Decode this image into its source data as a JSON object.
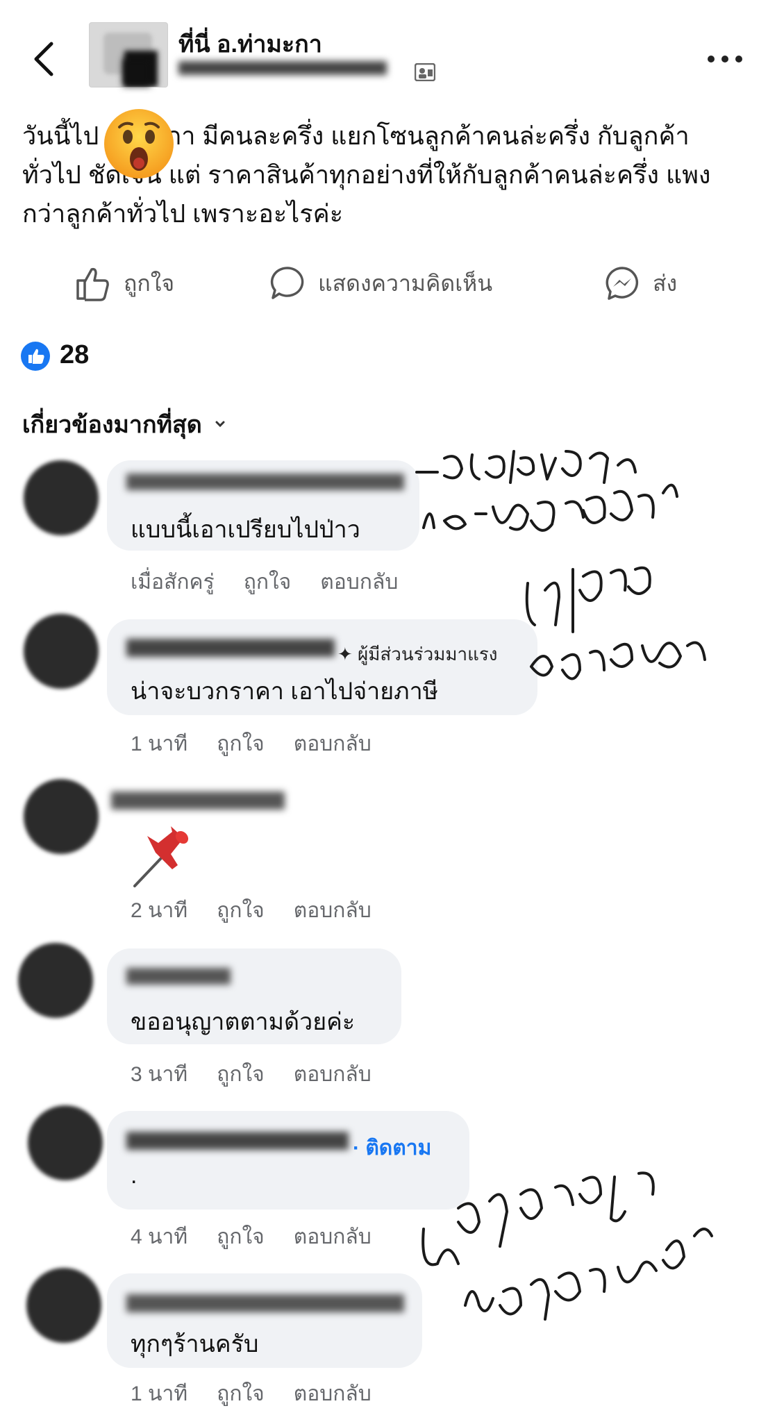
{
  "header": {
    "page_name": "ที่นี่ อ.ท่ามะกา"
  },
  "post": {
    "text": "วันนี้ไป       ท่ามะกา มีคนละครึ่ง แยกโซนลูกค้าคนล่ะครึ่ง กับลูกค้าทั่วไป ชัดเจน แต่ ราคาสินค้าทุกอย่างที่ให้กับลูกค้าคนล่ะครึ่ง แพงกว่าลูกค้าทั่วไป เพราะอะไรค่ะ",
    "emoji": "😮"
  },
  "actions": {
    "like": "ถูกใจ",
    "comment": "แสดงความคิดเห็น",
    "share": "ส่ง"
  },
  "reactions": {
    "count": "28"
  },
  "sort": {
    "label": "เกี่ยวข้องมากที่สุด"
  },
  "comments": [
    {
      "text": "แบบนี้เอาเปรียบไปป่าว",
      "time": "เมื่อสักครู่",
      "like": "ถูกใจ",
      "reply": "ตอบกลับ"
    },
    {
      "badge": "ผู้มีส่วนร่วมมาแรง",
      "text": "น่าจะบวกราคา เอาไปจ่ายภาษี",
      "time": "1 นาที",
      "like": "ถูกใจ",
      "reply": "ตอบกลับ"
    },
    {
      "sticker": "📌",
      "time": "2 นาที",
      "like": "ถูกใจ",
      "reply": "ตอบกลับ"
    },
    {
      "text": "ขออนุญาตตามด้วยค่ะ",
      "time": "3 นาที",
      "like": "ถูกใจ",
      "reply": "ตอบกลับ"
    },
    {
      "follow": "· ติดตาม",
      "text": ".",
      "time": "4 นาที",
      "like": "ถูกใจ",
      "reply": "ตอบกลับ"
    },
    {
      "text": "ทุกๆร้านครับ",
      "time": "1 นาที",
      "like": "ถูกใจ",
      "reply": "ตอบกลับ"
    }
  ],
  "handwriting": [
    "เอาเปรียบจริงและผิดกฎด้วย",
    "ไม่เกี่ยวกับภาษีเลย",
    "ผิดทุกร้านแจ้งตามได้"
  ]
}
